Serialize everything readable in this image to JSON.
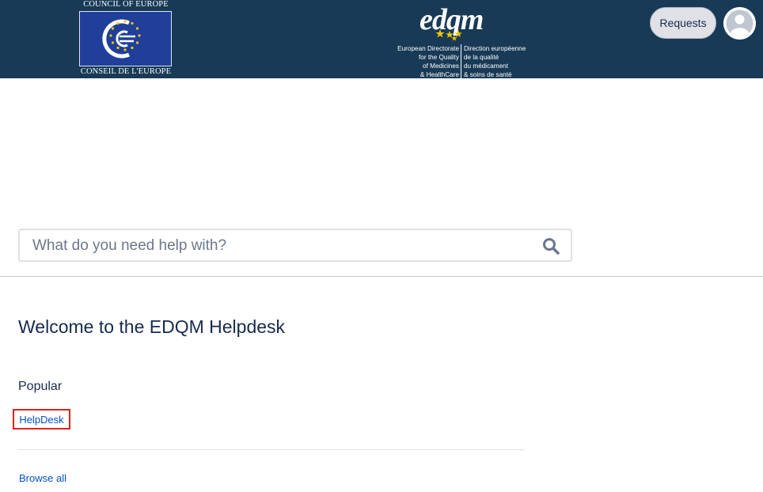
{
  "header": {
    "coe_logo": {
      "top_text": "COUNCIL OF EUROPE",
      "bottom_text": "CONSEIL DE L'EUROPE",
      "icon": "council-of-europe-emblem"
    },
    "edqm_logo": {
      "mark_text": "edqm",
      "left_lines": [
        "European Directorate",
        "for the Quality",
        "of Medicines",
        "& HealthCare"
      ],
      "right_lines": [
        "Direction européenne",
        "de la qualité",
        "du médicament",
        "& soins de santé"
      ]
    },
    "requests_label": "Requests",
    "avatar_icon": "user-avatar-icon"
  },
  "search": {
    "placeholder": "What do you need help with?",
    "icon": "search-icon"
  },
  "main": {
    "welcome_title": "Welcome to the EDQM Helpdesk",
    "popular_heading": "Popular",
    "popular_items": [
      "HelpDesk"
    ],
    "browse_all_label": "Browse all"
  },
  "colors": {
    "header_bg": "#183a56",
    "link": "#0052cc",
    "text": "#172b4d",
    "highlight_border": "#e0231c",
    "coe_blue": "#1f3f9a",
    "edqm_star": "#f5c400"
  }
}
